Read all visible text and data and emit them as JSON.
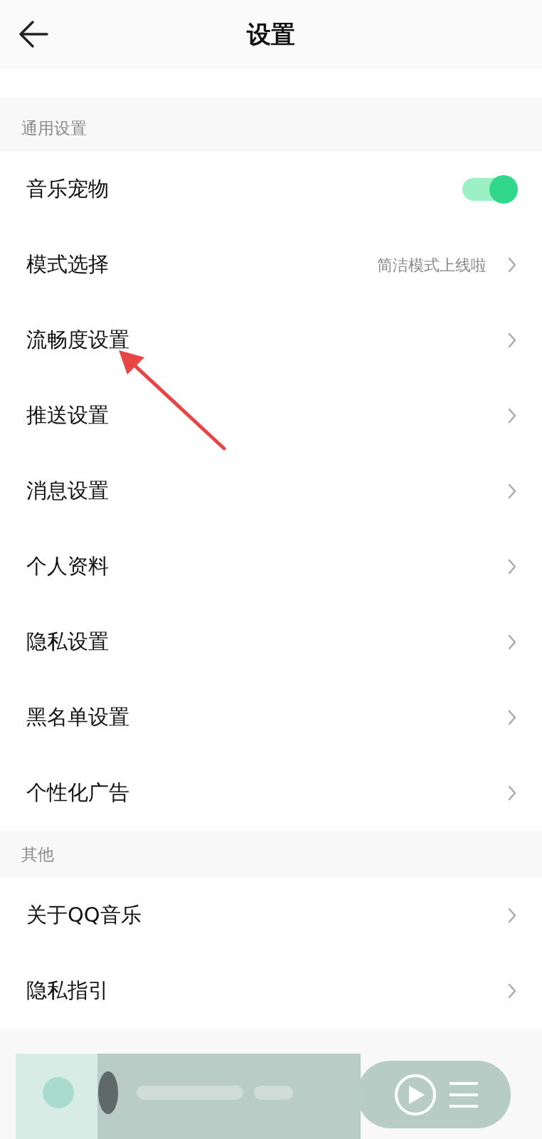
{
  "header": {
    "title": "设置"
  },
  "sections": [
    {
      "title": "通用设置",
      "items": [
        {
          "kind": "toggle",
          "label": "音乐宠物",
          "on": true
        },
        {
          "kind": "link",
          "label": "模式选择",
          "hint": "简洁模式上线啦"
        },
        {
          "kind": "link",
          "label": "流畅度设置"
        },
        {
          "kind": "link",
          "label": "推送设置"
        },
        {
          "kind": "link",
          "label": "消息设置"
        },
        {
          "kind": "link",
          "label": "个人资料"
        },
        {
          "kind": "link",
          "label": "隐私设置"
        },
        {
          "kind": "link",
          "label": "黑名单设置"
        },
        {
          "kind": "link",
          "label": "个性化广告"
        }
      ]
    },
    {
      "title": "其他",
      "items": [
        {
          "kind": "link",
          "label": "关于QQ音乐"
        },
        {
          "kind": "link",
          "label": "隐私指引"
        }
      ]
    }
  ]
}
